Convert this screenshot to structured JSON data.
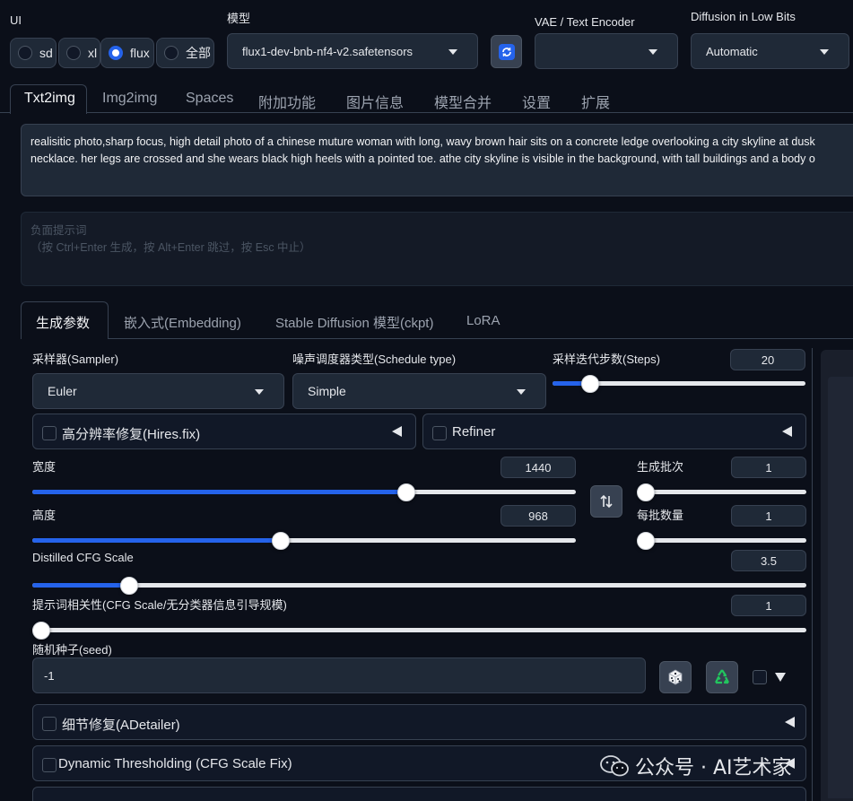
{
  "ui_selector": {
    "label": "UI",
    "options": [
      {
        "label": "sd",
        "selected": false
      },
      {
        "label": "xl",
        "selected": false
      },
      {
        "label": "flux",
        "selected": true
      },
      {
        "label": "全部",
        "selected": false
      }
    ]
  },
  "checkpoint": {
    "label": "模型",
    "value": "flux1-dev-bnb-nf4-v2.safetensors"
  },
  "vae": {
    "label": "VAE / Text Encoder",
    "value": ""
  },
  "low_bits": {
    "label": "Diffusion in Low Bits",
    "value": "Automatic"
  },
  "main_tabs": [
    "Txt2img",
    "Img2img",
    "Spaces",
    "附加功能",
    "图片信息",
    "模型合并",
    "设置",
    "扩展"
  ],
  "active_main_tab": "Txt2img",
  "prompt": {
    "line1": "realisitic photo,sharp focus, high detail photo of a chinese muture woman with long, wavy brown hair sits on a concrete ledge overlooking a city skyline at dusk",
    "line2": "necklace. her legs are crossed and she wears black high heels with a pointed toe.  athe city skyline is visible in the background, with tall buildings and a body o"
  },
  "negative_prompt": {
    "placeholder_line1": "负面提示词",
    "placeholder_line2": "（按 Ctrl+Enter 生成，按 Alt+Enter 跳过，按 Esc 中止）"
  },
  "sub_tabs": [
    "生成参数",
    "嵌入式(Embedding)",
    "Stable Diffusion 模型(ckpt)",
    "LoRA"
  ],
  "active_sub_tab": "生成参数",
  "sampler": {
    "label": "采样器(Sampler)",
    "value": "Euler"
  },
  "schedule": {
    "label": "噪声调度器类型(Schedule type)",
    "value": "Simple"
  },
  "steps": {
    "label": "采样迭代步数(Steps)",
    "value": "20",
    "fraction": 0.15
  },
  "hires": {
    "label": "高分辨率修复(Hires.fix)"
  },
  "refiner": {
    "label": "Refiner"
  },
  "width": {
    "label": "宽度",
    "value": "1440",
    "fraction": 0.69
  },
  "height": {
    "label": "高度",
    "value": "968",
    "fraction": 0.46
  },
  "batch_count": {
    "label": "生成批次",
    "value": "1",
    "fraction": 0
  },
  "batch_size": {
    "label": "每批数量",
    "value": "1",
    "fraction": 0
  },
  "distilled_cfg": {
    "label": "Distilled CFG Scale",
    "value": "3.5",
    "fraction": 0.12
  },
  "cfg_scale": {
    "label": "提示词相关性(CFG Scale/无分类器信息引导规模)",
    "value": "1",
    "fraction": 0
  },
  "seed": {
    "label": "随机种子(seed)",
    "value": "-1"
  },
  "adetailer": {
    "label": "细节修复(ADetailer)"
  },
  "dynamic_thresholding": {
    "label": "Dynamic Thresholding (CFG Scale Fix)"
  },
  "watermark": {
    "text": "公众号 · AI艺术家"
  },
  "colors": {
    "accent": "#2563eb",
    "background": "#0b0f19",
    "panel": "#1f2937"
  },
  "icons": {
    "refresh": "refresh-icon",
    "swap": "swap-icon",
    "dice": "dice-icon",
    "recycle": "recycle-icon"
  }
}
